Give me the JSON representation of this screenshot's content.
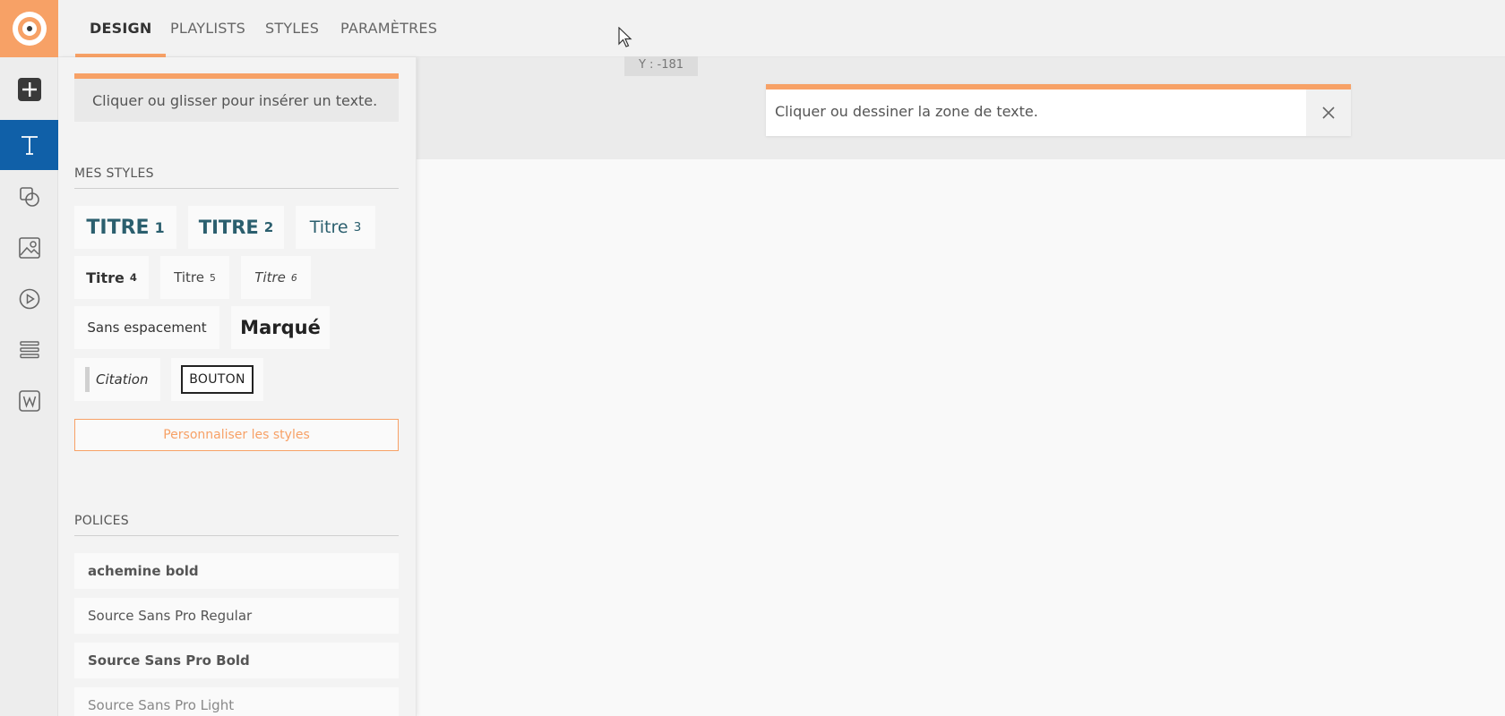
{
  "tabs": [
    {
      "label": "DESIGN",
      "active": true
    },
    {
      "label": "PLAYLISTS",
      "active": false
    },
    {
      "label": "STYLES",
      "active": false
    },
    {
      "label": "PARAMÈTRES",
      "active": false
    }
  ],
  "rail": {
    "icons": [
      "app-logo-icon",
      "add-icon",
      "text-icon",
      "shapes-icon",
      "image-icon",
      "play-icon",
      "list-icon",
      "widget-icon"
    ],
    "active": "text-icon"
  },
  "panel": {
    "insert_hint": "Cliquer ou glisser pour insérer un texte.",
    "styles_title": "MES STYLES",
    "styles": {
      "titre1": {
        "label": "TITRE",
        "num": "1"
      },
      "titre2": {
        "label": "TITRE",
        "num": "2"
      },
      "titre3": {
        "label": "Titre",
        "num": "3"
      },
      "titre4": {
        "label": "Titre",
        "num": "4"
      },
      "titre5": {
        "label": "Titre",
        "num": "5"
      },
      "titre6": {
        "label": "Titre",
        "num": "6"
      },
      "sans_espacement": "Sans espacement",
      "marque": "Marqué",
      "citation": "Citation",
      "bouton": "BOUTON"
    },
    "customize_label": "Personnaliser les styles",
    "fonts_title": "POLICES",
    "fonts": [
      {
        "label": "achemine bold",
        "weight": "bold"
      },
      {
        "label": "Source Sans Pro Regular",
        "weight": "normal"
      },
      {
        "label": "Source Sans Pro Bold",
        "weight": "bold"
      },
      {
        "label": "Source Sans Pro Light",
        "weight": "light"
      }
    ]
  },
  "canvas": {
    "coord_readout": "Y : -181",
    "hint": "Cliquer ou dessiner la zone de texte."
  },
  "colors": {
    "accent": "#f7a166",
    "active_rail": "#1060a8",
    "heading": "#2b5f6e"
  }
}
